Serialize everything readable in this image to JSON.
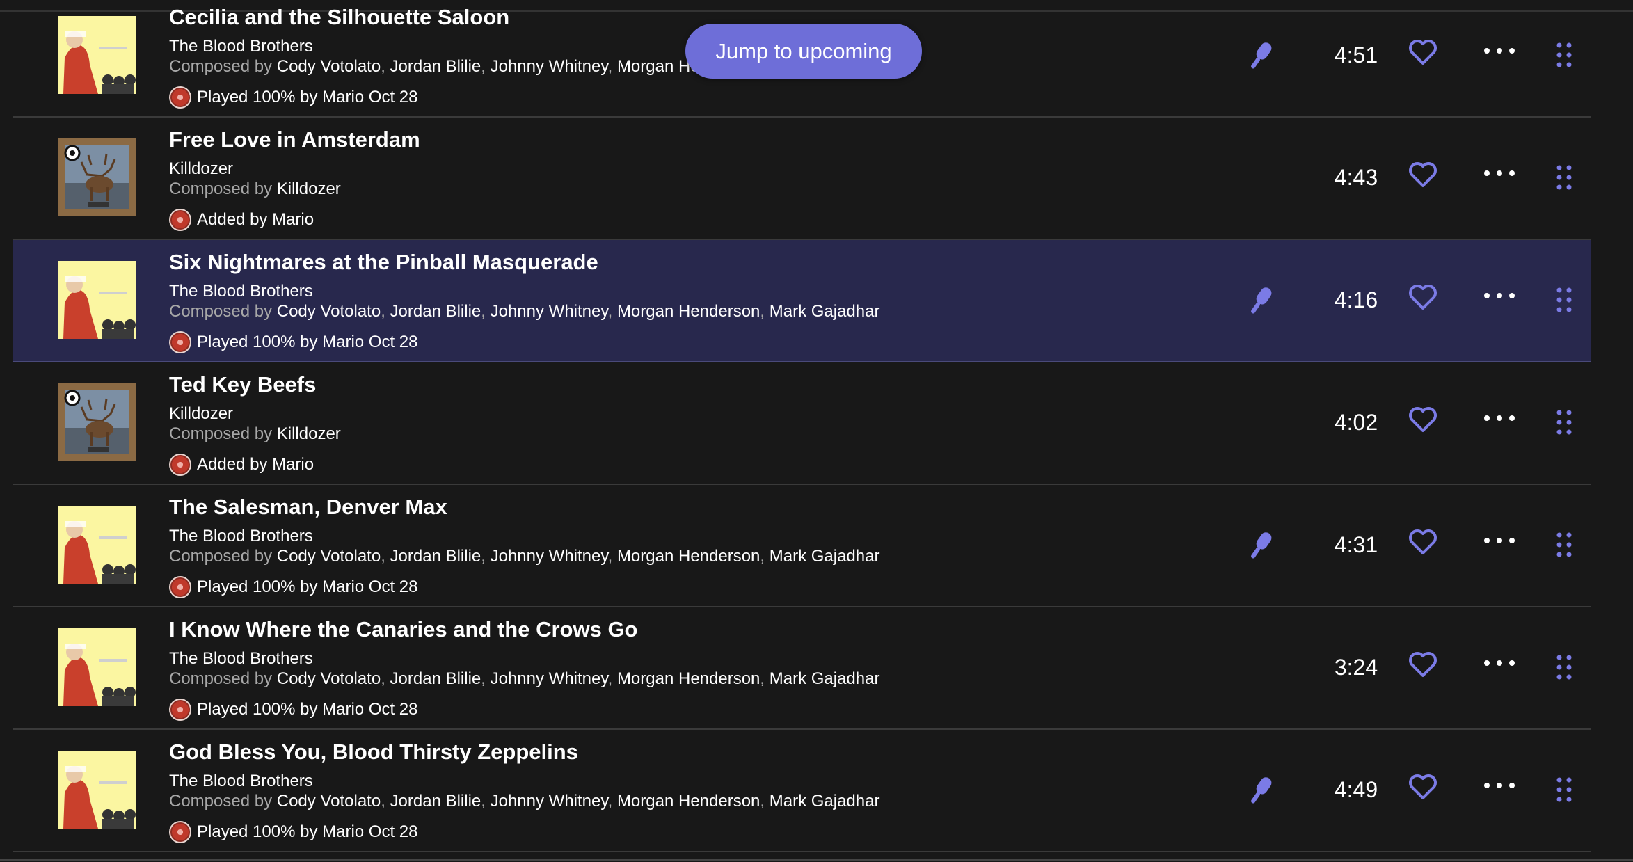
{
  "jump_button": {
    "label": "Jump to upcoming"
  },
  "composed_by_label": "Composed by",
  "tracks": [
    {
      "title": "Cecilia and the Silhouette Saloon",
      "artist": "The Blood Brothers",
      "composers": [
        "Cody Votolato",
        "Jordan Blilie",
        "Johnny Whitney",
        "Morgan He"
      ],
      "status": "Played 100% by Mario Oct 28",
      "duration": "4:51",
      "has_lyrics": true,
      "art": "yellow",
      "current": false
    },
    {
      "title": "Free Love in Amsterdam",
      "artist": "Killdozer",
      "composers": [
        "Killdozer"
      ],
      "status": "Added by Mario",
      "duration": "4:43",
      "has_lyrics": false,
      "art": "frame",
      "current": false
    },
    {
      "title": "Six Nightmares at the Pinball Masquerade",
      "artist": "The Blood Brothers",
      "composers": [
        "Cody Votolato",
        "Jordan Blilie",
        "Johnny Whitney",
        "Morgan Henderson",
        "Mark Gajadhar"
      ],
      "status": "Played 100% by Mario Oct 28",
      "duration": "4:16",
      "has_lyrics": true,
      "art": "yellow",
      "current": true
    },
    {
      "title": "Ted Key Beefs",
      "artist": "Killdozer",
      "composers": [
        "Killdozer"
      ],
      "status": "Added by Mario",
      "duration": "4:02",
      "has_lyrics": false,
      "art": "frame",
      "current": false
    },
    {
      "title": "The Salesman, Denver Max",
      "artist": "The Blood Brothers",
      "composers": [
        "Cody Votolato",
        "Jordan Blilie",
        "Johnny Whitney",
        "Morgan Henderson",
        "Mark Gajadhar"
      ],
      "status": "Played 100% by Mario Oct 28",
      "duration": "4:31",
      "has_lyrics": true,
      "art": "yellow",
      "current": false
    },
    {
      "title": "I Know Where the Canaries and the Crows Go",
      "artist": "The Blood Brothers",
      "composers": [
        "Cody Votolato",
        "Jordan Blilie",
        "Johnny Whitney",
        "Morgan Henderson",
        "Mark Gajadhar"
      ],
      "status": "Played 100% by Mario Oct 28",
      "duration": "3:24",
      "has_lyrics": false,
      "art": "yellow",
      "current": false
    },
    {
      "title": "God Bless You, Blood Thirsty Zeppelins",
      "artist": "The Blood Brothers",
      "composers": [
        "Cody Votolato",
        "Jordan Blilie",
        "Johnny Whitney",
        "Morgan Henderson",
        "Mark Gajadhar"
      ],
      "status": "Played 100% by Mario Oct 28",
      "duration": "4:49",
      "has_lyrics": true,
      "art": "yellow",
      "current": false
    }
  ],
  "colors": {
    "background": "#181818",
    "accent": "#6e6ed8",
    "current_row": "#28284d",
    "muted_text": "#a8a8a8"
  },
  "icons": [
    "microphone-icon",
    "heart-icon",
    "more-icon",
    "drag-handle-icon",
    "avatar"
  ]
}
